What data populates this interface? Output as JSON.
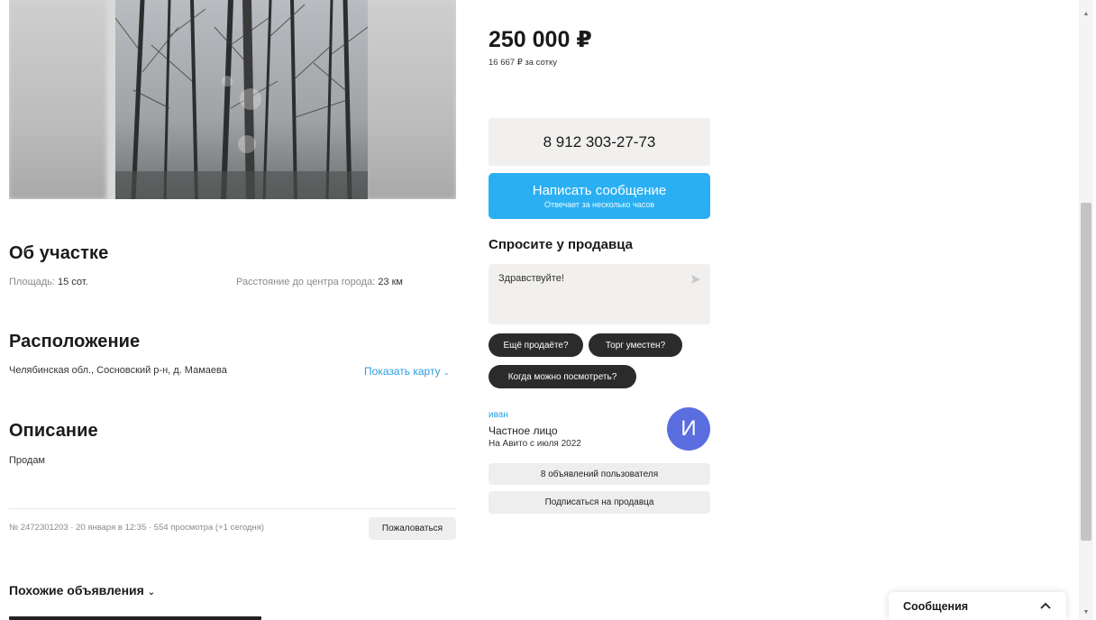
{
  "listing": {
    "price": "250 000 ₽",
    "price_per_unit": "16 667 ₽ за сотку"
  },
  "contact": {
    "phone": "8 912 303-27-73",
    "message_button": {
      "label": "Написать сообщение",
      "subtitle": "Отвечает за несколько часов"
    }
  },
  "ask_seller": {
    "title": "Спросите у продавца",
    "input_value": "Здравствуйте!",
    "quick_questions": [
      "Ещё продаёте?",
      "Торг уместен?",
      "Когда можно посмотреть?"
    ]
  },
  "seller": {
    "name": "иван",
    "type": "Частное лицо",
    "since": "На Авито с июля 2022",
    "avatar_letter": "И",
    "ads_button": "8 объявлений пользователя",
    "subscribe_button": "Подписаться на продавца"
  },
  "about": {
    "title": "Об участке",
    "area_label": "Площадь:",
    "area_value": "15 сот.",
    "distance_label": "Расстояние до центра города:",
    "distance_value": "23 км"
  },
  "location": {
    "title": "Расположение",
    "address": "Челябинская обл., Сосновский р-н, д. Мамаева",
    "show_map": "Показать карту"
  },
  "description": {
    "title": "Описание",
    "text": "Продам"
  },
  "meta": {
    "info": "№ 2472301203 · 20 января в 12:35 · 554 просмотра (+1 сегодня)",
    "report_button": "Пожаловаться"
  },
  "similar": {
    "title": "Похожие объявления"
  },
  "messages_panel": {
    "label": "Сообщения"
  },
  "colors": {
    "accent": "#2ab0f2",
    "link": "#2f9de0",
    "avatar": "#5a6ee0",
    "chip": "#2b2b2b"
  },
  "icons": {
    "send": "send-icon",
    "chevron_down": "chevron-down-icon",
    "chevron_up": "chevron-up-icon"
  }
}
